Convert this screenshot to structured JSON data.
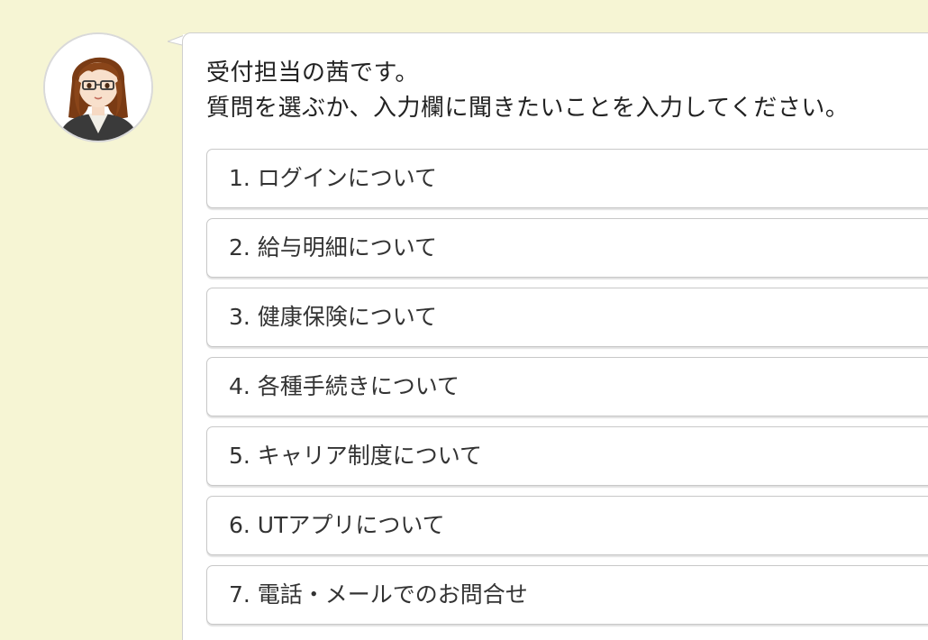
{
  "bot": {
    "avatar_icon": "receptionist-avatar-icon"
  },
  "message": {
    "line1": "受付担当の茜です。",
    "line2": "質問を選ぶか、入力欄に聞きたいことを入力してください。"
  },
  "options": [
    {
      "label": "1. ログインについて"
    },
    {
      "label": "2. 給与明細について"
    },
    {
      "label": "3. 健康保険について"
    },
    {
      "label": "4. 各種手続きについて"
    },
    {
      "label": "5. キャリア制度について"
    },
    {
      "label": "6. UTアプリについて"
    },
    {
      "label": "7. 電話・メールでのお問合せ"
    }
  ],
  "colors": {
    "background": "#f6f5d4",
    "bubble": "#ffffff",
    "border": "#c8c8c8",
    "text": "#333333"
  }
}
